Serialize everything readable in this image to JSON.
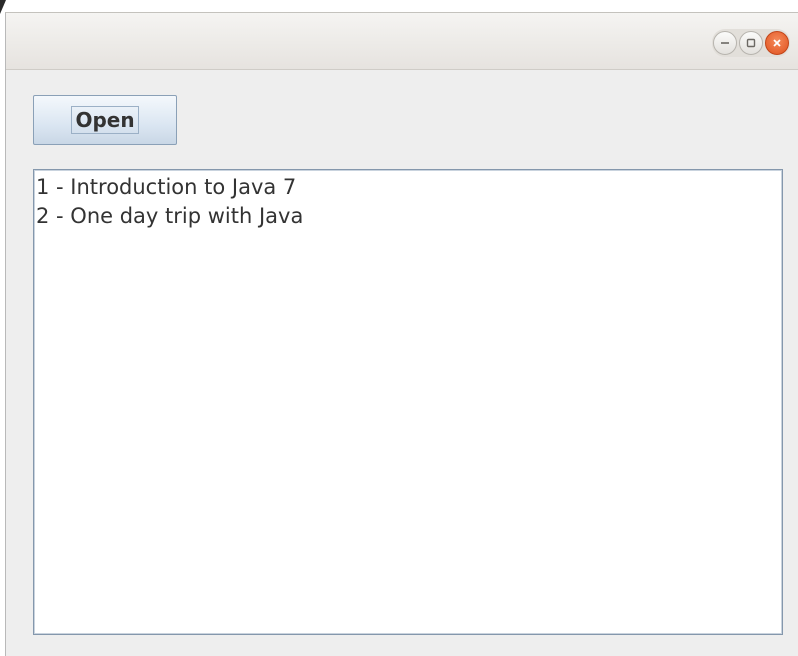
{
  "window": {
    "controls": [
      {
        "name": "minimize-icon",
        "glyph": "−"
      },
      {
        "name": "maximize-icon",
        "glyph": "□"
      },
      {
        "name": "close-icon",
        "glyph": "✕"
      }
    ]
  },
  "toolbar": {
    "open_label": "Open"
  },
  "textarea": {
    "lines": [
      "1 - Introduction to Java 7",
      "2 - One day trip with Java"
    ]
  },
  "colors": {
    "window_bg": "#eeeeee",
    "close_button": "#e0521f",
    "button_border": "#8aa0b7"
  }
}
